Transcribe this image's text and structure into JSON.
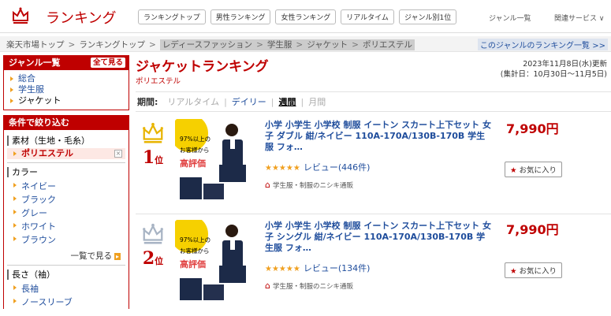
{
  "header": {
    "logo_text": "ランキング",
    "nav": [
      "ランキングトップ",
      "男性ランキング",
      "女性ランキング",
      "リアルタイム",
      "ジャンル別1位"
    ],
    "genre_list": "ジャンル一覧",
    "related": "関連サービス ∨"
  },
  "breadcrumb": {
    "items": [
      "楽天市場トップ",
      "ランキングトップ",
      "レディースファッション",
      "学生服",
      "ジャケット",
      "ポリエステル"
    ],
    "genre_ranking_link": "このジャンルのランキング一覧 >>"
  },
  "sidebar": {
    "genre_title": "ジャンル一覧",
    "see_all": "全て見る",
    "genres": [
      "総合",
      "学生服",
      "ジャケット"
    ],
    "filter_title": "条件で絞り込む",
    "material_title": "素材（生地・毛糸）",
    "material_selected": "ポリエステル",
    "color_title": "カラー",
    "colors": [
      "ネイビー",
      "ブラック",
      "グレー",
      "ホワイト",
      "ブラウン"
    ],
    "see_more": "一覧で見る",
    "length_title": "長さ（袖）",
    "lengths": [
      "長袖",
      "ノースリーブ"
    ]
  },
  "main": {
    "title": "ジャケットランキング",
    "subtitle": "ポリエステル",
    "date_line1": "2023年11月8日(水)更新",
    "date_line2": "(集計日：10月30日～11月5日)",
    "period_label": "期間:",
    "periods": [
      "リアルタイム",
      "デイリー",
      "週間",
      "月間"
    ]
  },
  "items": [
    {
      "rank": "1",
      "rank_suffix": "位",
      "title": "小学 小学生 小学校 制服 イートン スカート上下セット 女子 ダブル 紺/ネイビー 110A-170A/130B-170B 学生服 フォ…",
      "stars": "★★★★★",
      "reviews": "レビュー(446件)",
      "shop": "学生服・制服のニシキ通販",
      "price": "7,990円",
      "fav": "お気に入り",
      "badge_top": "97%以上の",
      "badge_mid": "お客様から",
      "badge_bottom": "高評価"
    },
    {
      "rank": "2",
      "rank_suffix": "位",
      "title": "小学 小学生 小学校 制服 イートン スカート上下セット 女子 シングル 紺/ネイビー 110A-170A/130B-170B 学生服 フォ…",
      "stars": "★★★★★",
      "reviews": "レビュー(134件)",
      "shop": "学生服・制服のニシキ通販",
      "price": "7,990円",
      "fav": "お気に入り",
      "badge_top": "97%以上の",
      "badge_mid": "お客様から",
      "badge_bottom": "高評価"
    }
  ]
}
